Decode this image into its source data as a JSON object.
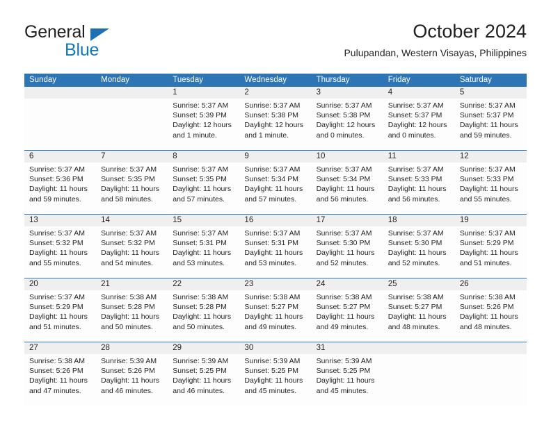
{
  "logo": {
    "word_top": "General",
    "word_bottom": "Blue",
    "triangle_color": "#1f6fb5",
    "blue_text_color": "#1278be"
  },
  "header": {
    "title": "October 2024",
    "subtitle": "Pulupandan, Western Visayas, Philippines"
  },
  "colors": {
    "header_blue": "#2e75b6",
    "daynum_band": "#efefef",
    "cell_bg": "#fdfdfd",
    "text": "#231f20"
  },
  "weekdays": [
    "Sunday",
    "Monday",
    "Tuesday",
    "Wednesday",
    "Thursday",
    "Friday",
    "Saturday"
  ],
  "weeks": [
    [
      {
        "day": "",
        "empty": true
      },
      {
        "day": "",
        "empty": true
      },
      {
        "day": "1",
        "sunrise": "Sunrise: 5:37 AM",
        "sunset": "Sunset: 5:39 PM",
        "daylight1": "Daylight: 12 hours",
        "daylight2": "and 1 minute."
      },
      {
        "day": "2",
        "sunrise": "Sunrise: 5:37 AM",
        "sunset": "Sunset: 5:38 PM",
        "daylight1": "Daylight: 12 hours",
        "daylight2": "and 1 minute."
      },
      {
        "day": "3",
        "sunrise": "Sunrise: 5:37 AM",
        "sunset": "Sunset: 5:38 PM",
        "daylight1": "Daylight: 12 hours",
        "daylight2": "and 0 minutes."
      },
      {
        "day": "4",
        "sunrise": "Sunrise: 5:37 AM",
        "sunset": "Sunset: 5:37 PM",
        "daylight1": "Daylight: 12 hours",
        "daylight2": "and 0 minutes."
      },
      {
        "day": "5",
        "sunrise": "Sunrise: 5:37 AM",
        "sunset": "Sunset: 5:37 PM",
        "daylight1": "Daylight: 11 hours",
        "daylight2": "and 59 minutes."
      }
    ],
    [
      {
        "day": "6",
        "sunrise": "Sunrise: 5:37 AM",
        "sunset": "Sunset: 5:36 PM",
        "daylight1": "Daylight: 11 hours",
        "daylight2": "and 59 minutes."
      },
      {
        "day": "7",
        "sunrise": "Sunrise: 5:37 AM",
        "sunset": "Sunset: 5:35 PM",
        "daylight1": "Daylight: 11 hours",
        "daylight2": "and 58 minutes."
      },
      {
        "day": "8",
        "sunrise": "Sunrise: 5:37 AM",
        "sunset": "Sunset: 5:35 PM",
        "daylight1": "Daylight: 11 hours",
        "daylight2": "and 57 minutes."
      },
      {
        "day": "9",
        "sunrise": "Sunrise: 5:37 AM",
        "sunset": "Sunset: 5:34 PM",
        "daylight1": "Daylight: 11 hours",
        "daylight2": "and 57 minutes."
      },
      {
        "day": "10",
        "sunrise": "Sunrise: 5:37 AM",
        "sunset": "Sunset: 5:34 PM",
        "daylight1": "Daylight: 11 hours",
        "daylight2": "and 56 minutes."
      },
      {
        "day": "11",
        "sunrise": "Sunrise: 5:37 AM",
        "sunset": "Sunset: 5:33 PM",
        "daylight1": "Daylight: 11 hours",
        "daylight2": "and 56 minutes."
      },
      {
        "day": "12",
        "sunrise": "Sunrise: 5:37 AM",
        "sunset": "Sunset: 5:33 PM",
        "daylight1": "Daylight: 11 hours",
        "daylight2": "and 55 minutes."
      }
    ],
    [
      {
        "day": "13",
        "sunrise": "Sunrise: 5:37 AM",
        "sunset": "Sunset: 5:32 PM",
        "daylight1": "Daylight: 11 hours",
        "daylight2": "and 55 minutes."
      },
      {
        "day": "14",
        "sunrise": "Sunrise: 5:37 AM",
        "sunset": "Sunset: 5:32 PM",
        "daylight1": "Daylight: 11 hours",
        "daylight2": "and 54 minutes."
      },
      {
        "day": "15",
        "sunrise": "Sunrise: 5:37 AM",
        "sunset": "Sunset: 5:31 PM",
        "daylight1": "Daylight: 11 hours",
        "daylight2": "and 53 minutes."
      },
      {
        "day": "16",
        "sunrise": "Sunrise: 5:37 AM",
        "sunset": "Sunset: 5:31 PM",
        "daylight1": "Daylight: 11 hours",
        "daylight2": "and 53 minutes."
      },
      {
        "day": "17",
        "sunrise": "Sunrise: 5:37 AM",
        "sunset": "Sunset: 5:30 PM",
        "daylight1": "Daylight: 11 hours",
        "daylight2": "and 52 minutes."
      },
      {
        "day": "18",
        "sunrise": "Sunrise: 5:37 AM",
        "sunset": "Sunset: 5:30 PM",
        "daylight1": "Daylight: 11 hours",
        "daylight2": "and 52 minutes."
      },
      {
        "day": "19",
        "sunrise": "Sunrise: 5:37 AM",
        "sunset": "Sunset: 5:29 PM",
        "daylight1": "Daylight: 11 hours",
        "daylight2": "and 51 minutes."
      }
    ],
    [
      {
        "day": "20",
        "sunrise": "Sunrise: 5:37 AM",
        "sunset": "Sunset: 5:29 PM",
        "daylight1": "Daylight: 11 hours",
        "daylight2": "and 51 minutes."
      },
      {
        "day": "21",
        "sunrise": "Sunrise: 5:38 AM",
        "sunset": "Sunset: 5:28 PM",
        "daylight1": "Daylight: 11 hours",
        "daylight2": "and 50 minutes."
      },
      {
        "day": "22",
        "sunrise": "Sunrise: 5:38 AM",
        "sunset": "Sunset: 5:28 PM",
        "daylight1": "Daylight: 11 hours",
        "daylight2": "and 50 minutes."
      },
      {
        "day": "23",
        "sunrise": "Sunrise: 5:38 AM",
        "sunset": "Sunset: 5:27 PM",
        "daylight1": "Daylight: 11 hours",
        "daylight2": "and 49 minutes."
      },
      {
        "day": "24",
        "sunrise": "Sunrise: 5:38 AM",
        "sunset": "Sunset: 5:27 PM",
        "daylight1": "Daylight: 11 hours",
        "daylight2": "and 49 minutes."
      },
      {
        "day": "25",
        "sunrise": "Sunrise: 5:38 AM",
        "sunset": "Sunset: 5:27 PM",
        "daylight1": "Daylight: 11 hours",
        "daylight2": "and 48 minutes."
      },
      {
        "day": "26",
        "sunrise": "Sunrise: 5:38 AM",
        "sunset": "Sunset: 5:26 PM",
        "daylight1": "Daylight: 11 hours",
        "daylight2": "and 48 minutes."
      }
    ],
    [
      {
        "day": "27",
        "sunrise": "Sunrise: 5:38 AM",
        "sunset": "Sunset: 5:26 PM",
        "daylight1": "Daylight: 11 hours",
        "daylight2": "and 47 minutes."
      },
      {
        "day": "28",
        "sunrise": "Sunrise: 5:39 AM",
        "sunset": "Sunset: 5:26 PM",
        "daylight1": "Daylight: 11 hours",
        "daylight2": "and 46 minutes."
      },
      {
        "day": "29",
        "sunrise": "Sunrise: 5:39 AM",
        "sunset": "Sunset: 5:25 PM",
        "daylight1": "Daylight: 11 hours",
        "daylight2": "and 46 minutes."
      },
      {
        "day": "30",
        "sunrise": "Sunrise: 5:39 AM",
        "sunset": "Sunset: 5:25 PM",
        "daylight1": "Daylight: 11 hours",
        "daylight2": "and 45 minutes."
      },
      {
        "day": "31",
        "sunrise": "Sunrise: 5:39 AM",
        "sunset": "Sunset: 5:25 PM",
        "daylight1": "Daylight: 11 hours",
        "daylight2": "and 45 minutes."
      },
      {
        "day": "",
        "empty": true
      },
      {
        "day": "",
        "empty": true
      }
    ]
  ]
}
